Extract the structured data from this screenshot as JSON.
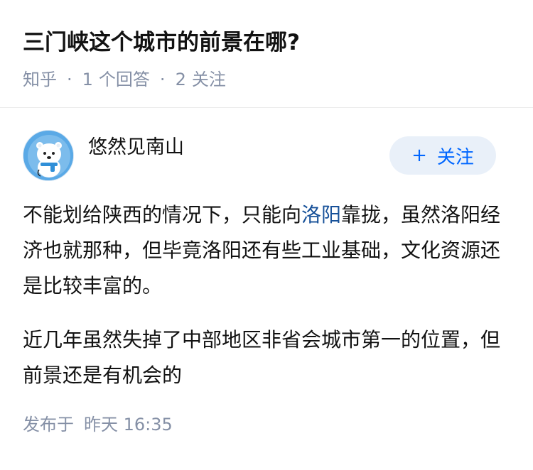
{
  "question": {
    "title": "三门峡这个城市的前景在哪?",
    "source": "知乎",
    "answer_count": "1",
    "answer_label": "个回答",
    "follower_count": "2",
    "follower_label": "关注",
    "separator": "·"
  },
  "answer": {
    "author_name": "悠然见南山",
    "avatar_icon": "cartoon-polar-bear-avatar",
    "follow_button": {
      "icon": "plus",
      "label": "关注"
    },
    "paragraph1": {
      "before_link": "不能划给陕西的情况下，只能向",
      "link_text": "洛阳",
      "after_link": "靠拢，虽然洛阳经济也就那种，但毕竟洛阳还有些工业基础，文化资源还是比较丰富的。"
    },
    "paragraph2": "近几年虽然失掉了中部地区非省会城市第一的位置，但前景还是有机会的",
    "publish": {
      "label": "发布于",
      "time": "昨天 16:35"
    }
  },
  "colors": {
    "link": "#175199",
    "follow_button_text": "#0066ff",
    "follow_button_bg": "#e9f0f9",
    "meta_text": "#8590a6",
    "title_text": "#121212"
  }
}
